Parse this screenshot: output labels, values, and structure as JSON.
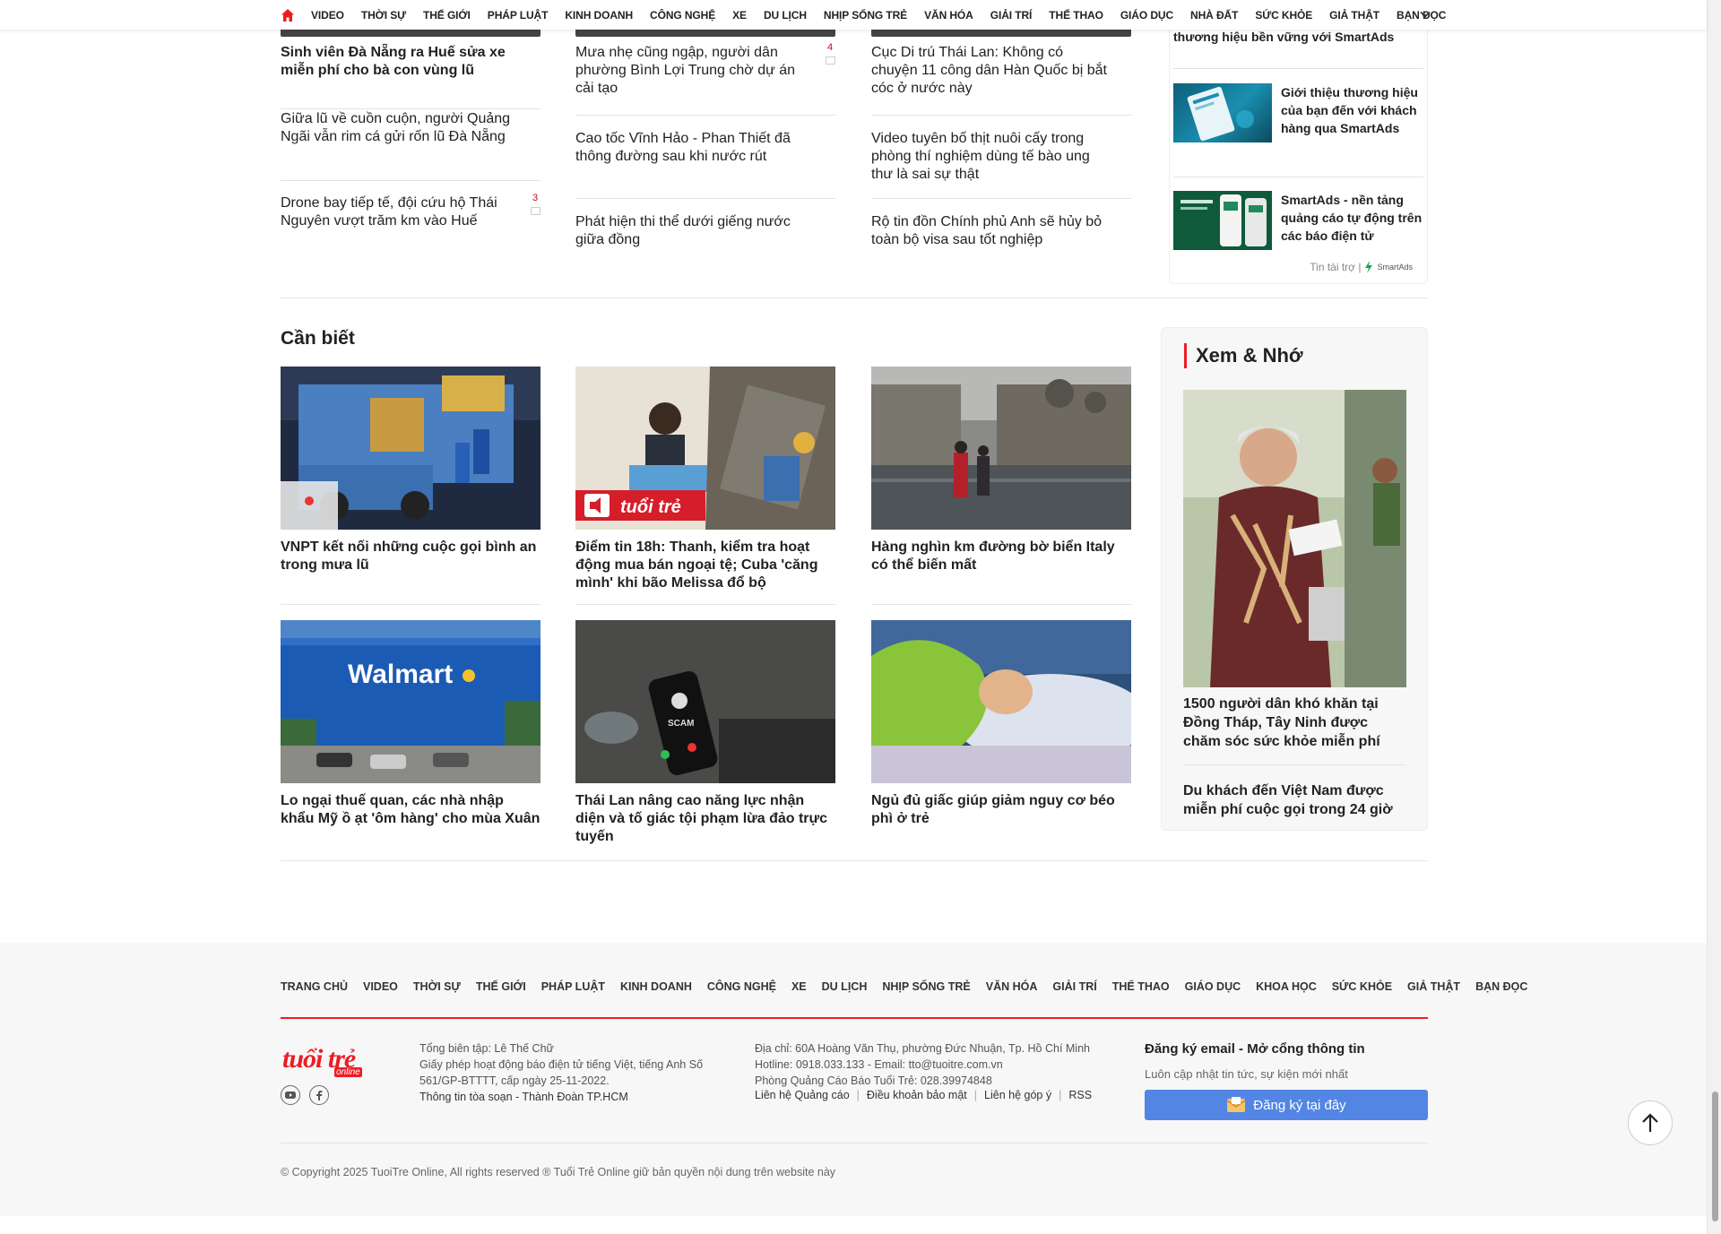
{
  "topnav": {
    "items": [
      "VIDEO",
      "THỜI SỰ",
      "THẾ GIỚI",
      "PHÁP LUẬT",
      "KINH DOANH",
      "CÔNG NGHỆ",
      "XE",
      "DU LỊCH",
      "NHỊP SỐNG TRẺ",
      "VĂN HÓA",
      "GIẢI TRÍ",
      "THỂ THAO",
      "GIÁO DỤC",
      "NHÀ ĐẤT",
      "SỨC KHỎE",
      "GIẢ THẬT",
      "BẠN ĐỌC"
    ]
  },
  "top_news": {
    "col1": [
      {
        "title": "Sinh viên Đà Nẵng ra Huế sửa xe miễn phí cho bà con vùng lũ"
      },
      {
        "title": "Giữa lũ về cuồn cuộn, người Quảng Ngãi vẫn rim cá gửi rốn lũ Đà Nẵng"
      },
      {
        "title": "Drone bay tiếp tế, đội cứu hộ Thái Nguyên vượt trăm km vào Huế",
        "comments": "3"
      }
    ],
    "col2": [
      {
        "title": "Mưa nhẹ cũng ngập, người dân phường Bình Lợi Trung chờ dự án cải tạo",
        "comments": "4"
      },
      {
        "title": "Cao tốc Vĩnh Hảo - Phan Thiết đã thông đường sau khi nước rút"
      },
      {
        "title": "Phát hiện thi thể dưới giếng nước giữa đồng"
      }
    ],
    "col3": [
      {
        "title": "Cục Di trú Thái Lan: Không có chuyện 11 công dân Hàn Quốc bị bắt cóc ở nước này"
      },
      {
        "title": "Video tuyên bố thịt nuôi cấy trong phòng thí nghiệm dùng tế bào ung thư là sai sự thật"
      },
      {
        "title": "Rộ tin đồn Chính phủ Anh sẽ hủy bỏ toàn bộ visa sau tốt nghiệp"
      }
    ]
  },
  "sponsor": {
    "partial_title": "thương hiệu bền vững với SmartAds",
    "items": [
      {
        "title": "Giới thiệu thương hiệu của bạn đến với khách hàng qua SmartAds"
      },
      {
        "title": "SmartAds - nền tảng quảng cáo tự động trên các báo điện tử"
      }
    ],
    "footer_label": "Tin tài trợ |",
    "brand": "SmartAds"
  },
  "can_biet": {
    "title": "Cần biết",
    "cards": [
      {
        "title": "VNPT kết nối những cuộc gọi bình an trong mưa lũ",
        "image": "truck-night-scene"
      },
      {
        "title": "Điểm tin 18h: Thanh, kiểm tra hoạt động mua bán ngoại tệ; Cuba 'căng mình' khi bão Melissa đổ bộ",
        "image": "bank-teller-storm"
      },
      {
        "title": "Hàng nghìn km đường bờ biển Italy có thể biến mất",
        "image": "venice-flood"
      },
      {
        "title": "Lo ngại thuế quan, các nhà nhập khẩu Mỹ ồ ạt 'ôm hàng' cho mùa Xuân",
        "image": "walmart-store"
      },
      {
        "title": "Thái Lan nâng cao năng lực nhận diện và tố giác tội phạm lừa đảo trực tuyến",
        "image": "scam-phone-call"
      },
      {
        "title": "Ngủ đủ giấc giúp giảm nguy cơ béo phì ở trẻ",
        "image": "sleeping-child"
      }
    ]
  },
  "xem_nho": {
    "title": "Xem & Nhớ",
    "items": [
      {
        "title": "1500 người dân khó khăn tại Đồng Tháp, Tây Ninh được chăm sóc sức khỏe miễn phí"
      },
      {
        "title": "Du khách đến Việt Nam được miễn phí cuộc gọi trong 24 giờ"
      }
    ]
  },
  "footer": {
    "nav": [
      "TRANG CHỦ",
      "VIDEO",
      "THỜI SỰ",
      "THẾ GIỚI",
      "PHÁP LUẬT",
      "KINH DOANH",
      "CÔNG NGHỆ",
      "XE",
      "DU LỊCH",
      "NHỊP SỐNG TRẺ",
      "VĂN HÓA",
      "GIẢI TRÍ",
      "THỂ THAO",
      "GIÁO DỤC",
      "KHOA HỌC",
      "SỨC KHỎE",
      "GIẢ THẬT",
      "BẠN ĐỌC"
    ],
    "logo_text": "tuổi trẻ",
    "logo_sub": "online",
    "editor": "Tổng biên tập: Lê Thế Chữ",
    "license": "Giấy phép hoạt động báo điện tử tiếng Việt, tiếng Anh Số 561/GP-BTTTT, cấp ngày 25-11-2022.",
    "office": "Thông tin tòa soạn - Thành Đoàn TP.HCM",
    "address": "Địa chỉ: 60A Hoàng Văn Thụ, phường Đức Nhuận, Tp. Hồ Chí Minh",
    "hotline": "Hotline: 0918.033.133 - Email: tto@tuoitre.com.vn",
    "ads_phone": "Phòng Quảng Cáo Báo Tuổi Trẻ: 028.39974848",
    "links": [
      "Liên hệ Quảng cáo",
      "Điều khoản bảo mật",
      "Liên hệ góp ý",
      "RSS"
    ],
    "register_title": "Đăng ký email - Mở cổng thông tin",
    "register_sub": "Luôn cập nhật tin tức, sự kiện mới nhất",
    "register_button": "Đăng ký tại đây",
    "copyright": "© Copyright 2025 TuoiTre Online, All rights reserved ® Tuổi Trẻ Online giữ bản quyền nội dung trên website này"
  },
  "colors": {
    "accent": "#ed1c24",
    "button": "#5386e4"
  }
}
